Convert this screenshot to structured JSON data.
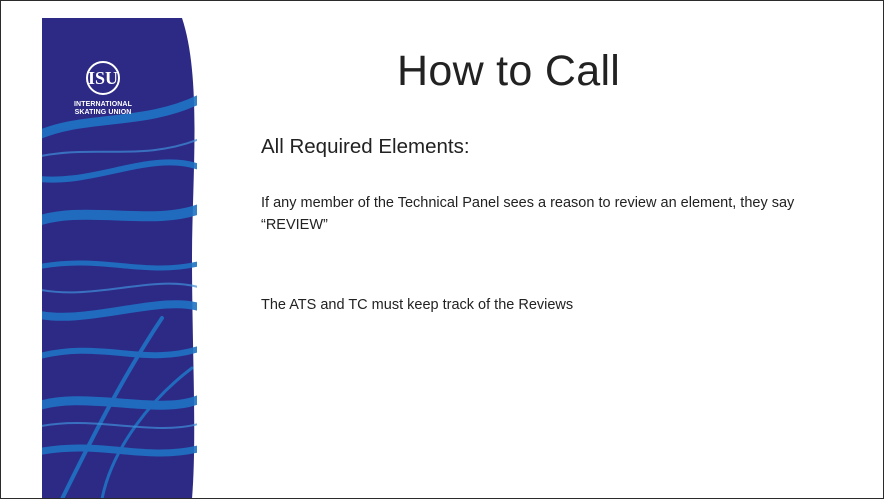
{
  "slide": {
    "title": "How to Call",
    "subtitle": "All Required Elements:",
    "paragraphs": [
      "If any member of the Technical Panel sees a reason to review an element, they say “REVIEW”",
      "The ATS and TC must keep track of the Reviews"
    ]
  },
  "logo": {
    "mark": "ISU",
    "line1": "INTERNATIONAL",
    "line2": "SKATING UNION"
  },
  "colors": {
    "panel": "#2d2a86",
    "swirl": "#1f73c4",
    "text": "#222222"
  }
}
